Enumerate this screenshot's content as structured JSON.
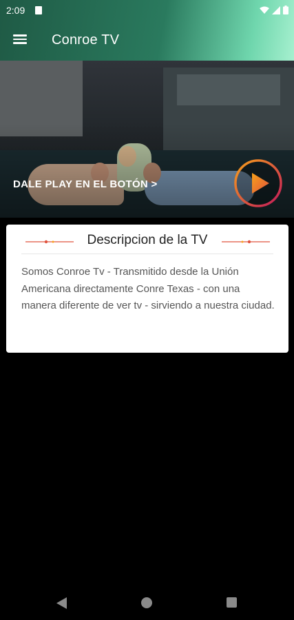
{
  "status_bar": {
    "time": "2:09",
    "icons": [
      "sd-card-icon",
      "wifi-icon",
      "signal-icon",
      "battery-icon"
    ]
  },
  "toolbar": {
    "title": "Conroe TV",
    "menu_icon": "hamburger-menu-icon"
  },
  "hero": {
    "cta_label": "DALE PLAY EN EL BOTÓN >",
    "play_icon": "play-icon"
  },
  "description_card": {
    "title": "Descripcion de la TV",
    "body": "Somos Conroe Tv - Transmitido desde la Unión Americana directamente Conre Texas - con una manera diferente de ver tv - sirviendo a nuestra ciudad."
  },
  "nav_bar": {
    "icons": [
      "back-icon",
      "home-icon",
      "recents-icon"
    ]
  },
  "colors": {
    "toolbar_gradient_start": "#1f5a45",
    "toolbar_gradient_end": "#a6f0cf",
    "play_ring_start": "#f7a11a",
    "play_ring_end": "#c2185b",
    "decor_accent": "#e0533d"
  }
}
